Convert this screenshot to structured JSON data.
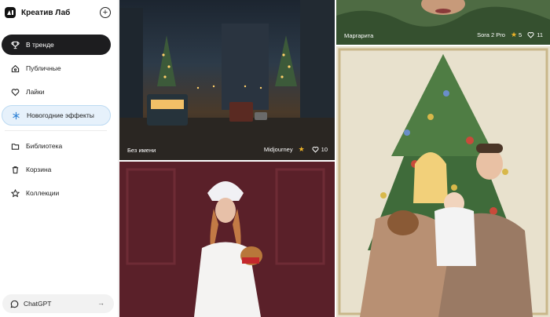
{
  "brand": {
    "name": "Креатив Лаб"
  },
  "nav": {
    "trending": "В тренде",
    "public": "Публичные",
    "likes": "Лайки",
    "newyear": "Новогодние эффекты",
    "library": "Библиотека",
    "trash": "Корзина",
    "collections": "Коллекции"
  },
  "chat": {
    "label": "ChatGPT"
  },
  "cards": [
    {
      "caption": "Без имени",
      "model": "Midjourney",
      "likes": "10"
    },
    {
      "caption": "Маргарита",
      "model": "Sora 2 Pro",
      "rating": "5",
      "likes": "11"
    }
  ],
  "colors": {
    "active": "#1d1d1f",
    "highlight": "#e6f1fb",
    "star": "#f0b428"
  }
}
